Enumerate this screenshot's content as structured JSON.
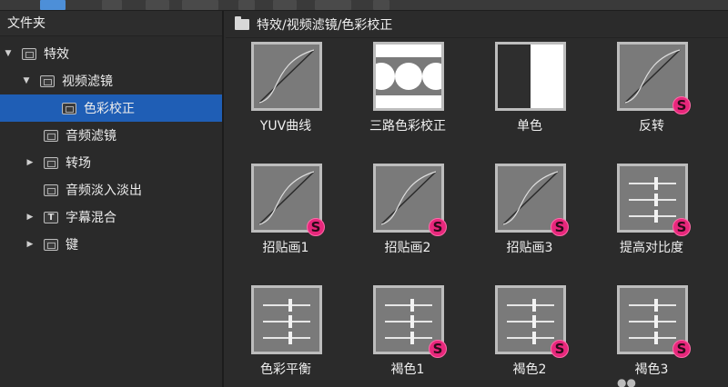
{
  "toolbar": {
    "buttons": [
      "view-button",
      "up-button",
      "link-button",
      "add-button",
      "refresh-button",
      "list-button",
      "grid-button",
      "info-button"
    ]
  },
  "left_panel": {
    "header": "文件夹",
    "tree": [
      {
        "label": "特效",
        "expanded": true,
        "arrow": "▼"
      },
      {
        "label": "视频滤镜",
        "expanded": true,
        "arrow": "▼"
      },
      {
        "label": "色彩校正",
        "selected": true
      },
      {
        "label": "音频滤镜"
      },
      {
        "label": "转场",
        "arrow": "▶"
      },
      {
        "label": "音频淡入淡出"
      },
      {
        "label": "字幕混合",
        "arrow": "▶"
      },
      {
        "label": "键",
        "arrow": "▶"
      }
    ]
  },
  "right_panel": {
    "path": "特效/视频滤镜/色彩校正",
    "items": [
      {
        "label": "YUV曲线",
        "thumb": "curve",
        "badge": false
      },
      {
        "label": "三路色彩校正",
        "thumb": "circles",
        "badge": false
      },
      {
        "label": "单色",
        "thumb": "mono",
        "badge": false
      },
      {
        "label": "反转",
        "thumb": "curve",
        "badge": true
      },
      {
        "label": "招贴画1",
        "thumb": "curve",
        "badge": true
      },
      {
        "label": "招贴画2",
        "thumb": "curve",
        "badge": true
      },
      {
        "label": "招贴画3",
        "thumb": "curve",
        "badge": true
      },
      {
        "label": "提高对比度",
        "thumb": "sliders",
        "badge": true
      },
      {
        "label": "色彩平衡",
        "thumb": "sliders",
        "badge": false
      },
      {
        "label": "褐色1",
        "thumb": "sliders",
        "badge": true
      },
      {
        "label": "褐色2",
        "thumb": "sliders",
        "badge": true
      },
      {
        "label": "褐色3",
        "thumb": "sliders",
        "badge": true
      }
    ],
    "badge_text": "S",
    "badge_color": "#e8277c"
  }
}
